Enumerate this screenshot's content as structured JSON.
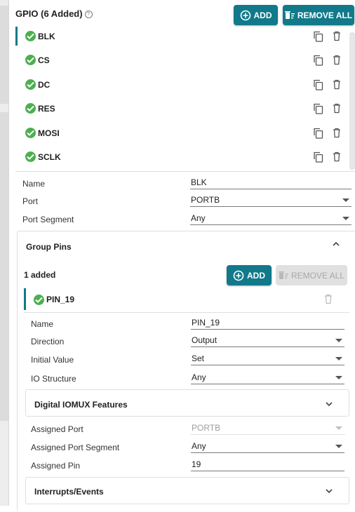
{
  "header": {
    "title": "GPIO (6 Added)",
    "help_icon": "help-circle-icon"
  },
  "toolbar": {
    "add_label": "ADD",
    "remove_all_label": "REMOVE ALL",
    "accent": "#11798a"
  },
  "gpio_items": [
    {
      "label": "BLK",
      "status": "ok",
      "selected": true
    },
    {
      "label": "CS",
      "status": "ok"
    },
    {
      "label": "DC",
      "status": "ok"
    },
    {
      "label": "RES",
      "status": "ok"
    },
    {
      "label": "MOSI",
      "status": "ok"
    },
    {
      "label": "SCLK",
      "status": "ok"
    }
  ],
  "properties": {
    "name_label": "Name",
    "name_value": "BLK",
    "port_label": "Port",
    "port_value": "PORTB",
    "port_segment_label": "Port Segment",
    "port_segment_value": "Any"
  },
  "group_pins": {
    "title": "Group Pins",
    "count_label": "1 added",
    "add_label": "ADD",
    "remove_all_label": "REMOVE ALL",
    "pin": {
      "label": "PIN_19",
      "status": "ok"
    },
    "fields": {
      "name_label": "Name",
      "name_value": "PIN_19",
      "direction_label": "Direction",
      "direction_value": "Output",
      "initial_label": "Initial Value",
      "initial_value": "Set",
      "io_label": "IO Structure",
      "io_value": "Any"
    },
    "iomux": {
      "title": "Digital IOMUX Features",
      "assigned_port_label": "Assigned Port",
      "assigned_port_value": "PORTB",
      "assigned_segment_label": "Assigned Port Segment",
      "assigned_segment_value": "Any",
      "assigned_pin_label": "Assigned Pin",
      "assigned_pin_value": "19"
    },
    "interrupts": {
      "title": "Interrupts/Events"
    }
  },
  "colors": {
    "success": "#4caf50",
    "accent": "#11798a",
    "disabled": "#e0e0e0"
  }
}
